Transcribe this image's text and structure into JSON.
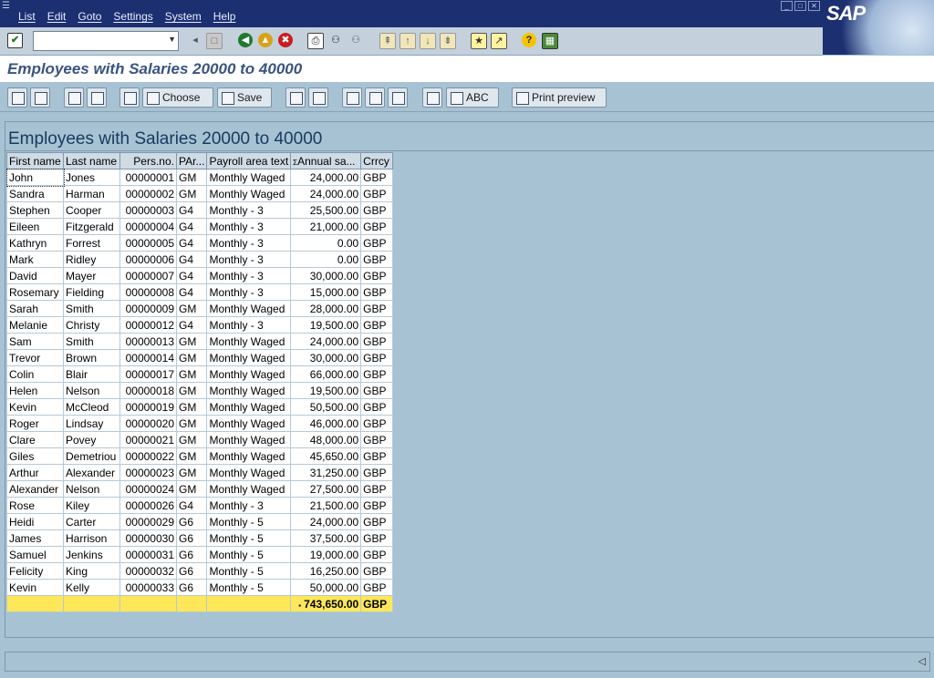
{
  "menu": {
    "items": [
      "List",
      "Edit",
      "Goto",
      "Settings",
      "System",
      "Help"
    ],
    "brand": "SAP"
  },
  "toolbar": {
    "command_value": "",
    "icons": [
      "enter-check-icon",
      "command-dropdown-icon",
      "back-nav-icon",
      "save-disk-icon",
      "back-icon",
      "exit-icon",
      "cancel-icon",
      "print-icon",
      "find-icon",
      "find-next-icon",
      "first-page-icon",
      "previous-page-icon",
      "next-page-icon",
      "last-page-icon",
      "create-session-icon",
      "shortcut-icon",
      "help-icon",
      "layout-icon"
    ]
  },
  "page": {
    "title": "Employees with Salaries 20000 to 40000"
  },
  "app_toolbar": {
    "choose_label": "Choose",
    "save_label": "Save",
    "abc_label": "ABC",
    "print_preview_label": "Print preview"
  },
  "report": {
    "heading": "Employees with Salaries 20000 to 40000",
    "columns": [
      "First name",
      "Last name",
      "Pers.no.",
      "PAr...",
      "Payroll area text",
      "Annual sa...",
      "Crrcy"
    ],
    "rows": [
      [
        "John",
        "Jones",
        "00000001",
        "GM",
        "Monthly Waged",
        "24,000.00",
        "GBP"
      ],
      [
        "Sandra",
        "Harman",
        "00000002",
        "GM",
        "Monthly Waged",
        "24,000.00",
        "GBP"
      ],
      [
        "Stephen",
        "Cooper",
        "00000003",
        "G4",
        "Monthly - 3",
        "25,500.00",
        "GBP"
      ],
      [
        "Eileen",
        "Fitzgerald",
        "00000004",
        "G4",
        "Monthly - 3",
        "21,000.00",
        "GBP"
      ],
      [
        "Kathryn",
        "Forrest",
        "00000005",
        "G4",
        "Monthly - 3",
        "0.00",
        "GBP"
      ],
      [
        "Mark",
        "Ridley",
        "00000006",
        "G4",
        "Monthly - 3",
        "0.00",
        "GBP"
      ],
      [
        "David",
        "Mayer",
        "00000007",
        "G4",
        "Monthly - 3",
        "30,000.00",
        "GBP"
      ],
      [
        "Rosemary",
        "Fielding",
        "00000008",
        "G4",
        "Monthly - 3",
        "15,000.00",
        "GBP"
      ],
      [
        "Sarah",
        "Smith",
        "00000009",
        "GM",
        "Monthly Waged",
        "28,000.00",
        "GBP"
      ],
      [
        "Melanie",
        "Christy",
        "00000012",
        "G4",
        "Monthly - 3",
        "19,500.00",
        "GBP"
      ],
      [
        "Sam",
        "Smith",
        "00000013",
        "GM",
        "Monthly Waged",
        "24,000.00",
        "GBP"
      ],
      [
        "Trevor",
        "Brown",
        "00000014",
        "GM",
        "Monthly Waged",
        "30,000.00",
        "GBP"
      ],
      [
        "Colin",
        "Blair",
        "00000017",
        "GM",
        "Monthly Waged",
        "66,000.00",
        "GBP"
      ],
      [
        "Helen",
        "Nelson",
        "00000018",
        "GM",
        "Monthly Waged",
        "19,500.00",
        "GBP"
      ],
      [
        "Kevin",
        "McCleod",
        "00000019",
        "GM",
        "Monthly Waged",
        "50,500.00",
        "GBP"
      ],
      [
        "Roger",
        "Lindsay",
        "00000020",
        "GM",
        "Monthly Waged",
        "46,000.00",
        "GBP"
      ],
      [
        "Clare",
        "Povey",
        "00000021",
        "GM",
        "Monthly Waged",
        "48,000.00",
        "GBP"
      ],
      [
        "Giles",
        "Demetriou",
        "00000022",
        "GM",
        "Monthly Waged",
        "45,650.00",
        "GBP"
      ],
      [
        "Arthur",
        "Alexander",
        "00000023",
        "GM",
        "Monthly Waged",
        "31,250.00",
        "GBP"
      ],
      [
        "Alexander",
        "Nelson",
        "00000024",
        "GM",
        "Monthly Waged",
        "27,500.00",
        "GBP"
      ],
      [
        "Rose",
        "Kiley",
        "00000026",
        "G4",
        "Monthly - 3",
        "21,500.00",
        "GBP"
      ],
      [
        "Heidi",
        "Carter",
        "00000029",
        "G6",
        "Monthly - 5",
        "24,000.00",
        "GBP"
      ],
      [
        "James",
        "Harrison",
        "00000030",
        "G6",
        "Monthly - 5",
        "37,500.00",
        "GBP"
      ],
      [
        "Samuel",
        "Jenkins",
        "00000031",
        "G6",
        "Monthly - 5",
        "19,000.00",
        "GBP"
      ],
      [
        "Felicity",
        "King",
        "00000032",
        "G6",
        "Monthly - 5",
        "16,250.00",
        "GBP"
      ],
      [
        "Kevin",
        "Kelly",
        "00000033",
        "G6",
        "Monthly - 5",
        "50,000.00",
        "GBP"
      ]
    ],
    "total": {
      "marker": "▪",
      "value": "743,650.00",
      "currency": "GBP"
    }
  },
  "colors": {
    "menubar": "#1c2f70",
    "background": "#a7c2d3",
    "total_row": "#ffe75a",
    "title_text": "#3a5480"
  }
}
